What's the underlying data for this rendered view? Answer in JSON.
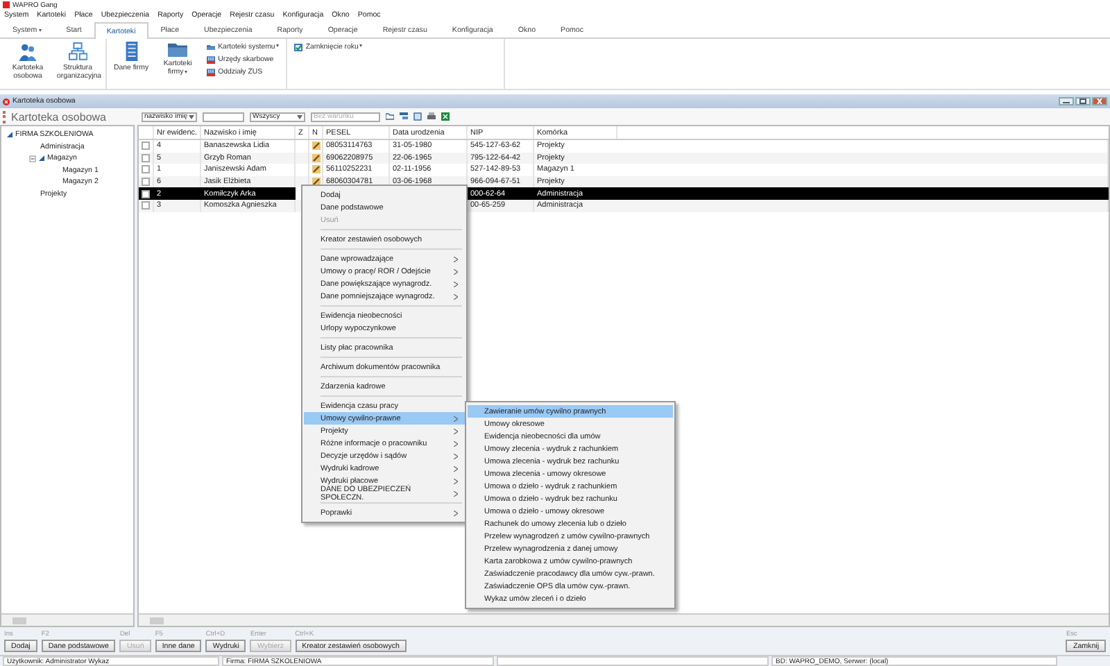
{
  "app": {
    "title": "WAPRO Gang"
  },
  "menu_bar": [
    "System",
    "Kartoteki",
    "Płace",
    "Ubezpieczenia",
    "Raporty",
    "Operacje",
    "Rejestr czasu",
    "Konfiguracja",
    "Okno",
    "Pomoc"
  ],
  "ribbon_tabs": [
    {
      "label": "System",
      "selected": false,
      "dropdown": true
    },
    {
      "label": "Start",
      "selected": false,
      "dropdown": false
    },
    {
      "label": "Kartoteki",
      "selected": true,
      "dropdown": false
    },
    {
      "label": "Płace",
      "selected": false,
      "dropdown": false
    },
    {
      "label": "Ubezpieczenia",
      "selected": false,
      "dropdown": false
    },
    {
      "label": "Raporty",
      "selected": false,
      "dropdown": false
    },
    {
      "label": "Operacje",
      "selected": false,
      "dropdown": false
    },
    {
      "label": "Rejestr czasu",
      "selected": false,
      "dropdown": false
    },
    {
      "label": "Konfiguracja",
      "selected": false,
      "dropdown": false
    },
    {
      "label": "Okno",
      "selected": false,
      "dropdown": false
    },
    {
      "label": "Pomoc",
      "selected": false,
      "dropdown": false
    }
  ],
  "ribbon_groups": [
    {
      "large_buttons": [
        {
          "label": "Kartoteka osobowa",
          "dropdown": false
        },
        {
          "label": "Struktura organizacyjna",
          "dropdown": false
        }
      ]
    },
    {
      "large_buttons": [
        {
          "label": "Dane firmy",
          "dropdown": false
        },
        {
          "label": "Kartoteki firmy",
          "dropdown": true
        }
      ],
      "small_buttons": [
        {
          "label": "Kartoteki systemu",
          "dropdown": true
        },
        {
          "label": "Urzędy skarbowe",
          "dropdown": false
        },
        {
          "label": "Oddziały ZUS",
          "dropdown": false
        }
      ]
    },
    {
      "small_buttons": [
        {
          "label": "Zamknięcie roku",
          "dropdown": true
        }
      ]
    }
  ],
  "document": {
    "title": "Kartoteka osobowa",
    "heading": "Kartoteka osobowa",
    "sort_select": "nazwisko imię",
    "status_select": "Wszyscy",
    "condition": {
      "placeholder": "Bez warunku"
    }
  },
  "tree": [
    {
      "label": "FIRMA SZKOLENIOWA",
      "expanded": true,
      "children": [
        {
          "label": "Administracja"
        },
        {
          "label": "Magazyn",
          "expanded": true,
          "children": [
            {
              "label": "Magazyn 1"
            },
            {
              "label": "Magazyn 2"
            }
          ]
        },
        {
          "label": "Projekty"
        }
      ]
    }
  ],
  "table": {
    "columns": [
      "Nr ewidenc.",
      "Nazwisko i imię",
      "Z",
      "N",
      "PESEL",
      "Data urodzenia",
      "NIP",
      "Komórka"
    ],
    "rows": [
      {
        "selected": false,
        "note": true,
        "cells": [
          "4",
          "Banaszewska Lidia",
          "",
          "",
          "08053114763",
          "31-05-1980",
          "545-127-63-62",
          "Projekty"
        ]
      },
      {
        "selected": false,
        "note": true,
        "cells": [
          "5",
          "Grzyb Roman",
          "",
          "",
          "69062208975",
          "22-06-1965",
          "795-122-64-42",
          "Projekty"
        ]
      },
      {
        "selected": false,
        "note": true,
        "cells": [
          "1",
          "Janiszewski Adam",
          "",
          "",
          "56110252231",
          "02-11-1956",
          "527-142-89-53",
          "Magazyn 1"
        ]
      },
      {
        "selected": false,
        "note": true,
        "cells": [
          "6",
          "Jasik Elżbieta",
          "",
          "",
          "68060304781",
          "03-06-1968",
          "966-094-67-51",
          "Projekty"
        ]
      },
      {
        "selected": true,
        "cells": [
          "2",
          "Komiłczyk Arka",
          "",
          "",
          "",
          "",
          "000-62-64",
          "Administracja"
        ]
      },
      {
        "selected": false,
        "cells": [
          "3",
          "Komoszka Agnieszka",
          "",
          "",
          "",
          "",
          "00-65-259",
          "Administracja"
        ]
      }
    ]
  },
  "context_menu": [
    {
      "kind": "item",
      "label": "Dodaj",
      "disabled": false,
      "submenu": false,
      "selected": false
    },
    {
      "kind": "item",
      "label": "Dane podstawowe",
      "disabled": false,
      "submenu": false,
      "selected": false
    },
    {
      "kind": "item",
      "label": "Usuń",
      "disabled": true,
      "submenu": false,
      "selected": false
    },
    {
      "kind": "separator"
    },
    {
      "kind": "item",
      "label": "Kreator zestawień osobowych",
      "disabled": false,
      "submenu": false,
      "selected": false
    },
    {
      "kind": "separator"
    },
    {
      "kind": "item",
      "label": "Dane wprowadzające",
      "disabled": false,
      "submenu": true,
      "selected": false
    },
    {
      "kind": "item",
      "label": "Umowy o pracę/ ROR / Odejście",
      "disabled": false,
      "submenu": true,
      "selected": false
    },
    {
      "kind": "item",
      "label": "Dane powiększające wynagrodz.",
      "disabled": false,
      "submenu": true,
      "selected": false
    },
    {
      "kind": "item",
      "label": "Dane pomniejszające wynagrodz.",
      "disabled": false,
      "submenu": true,
      "selected": false
    },
    {
      "kind": "separator"
    },
    {
      "kind": "item",
      "label": "Ewidencja nieobecności",
      "disabled": false,
      "submenu": false,
      "selected": false
    },
    {
      "kind": "item",
      "label": "Urlopy wypoczynkowe",
      "disabled": false,
      "submenu": false,
      "selected": false
    },
    {
      "kind": "separator"
    },
    {
      "kind": "item",
      "label": "Listy płac pracownika",
      "disabled": false,
      "submenu": false,
      "selected": false
    },
    {
      "kind": "separator"
    },
    {
      "kind": "item",
      "label": "Archiwum dokumentów pracownika",
      "disabled": false,
      "submenu": false,
      "selected": false
    },
    {
      "kind": "separator"
    },
    {
      "kind": "item",
      "label": "Zdarzenia kadrowe",
      "disabled": false,
      "submenu": false,
      "selected": false
    },
    {
      "kind": "separator"
    },
    {
      "kind": "item",
      "label": "Ewidencja czasu pracy",
      "disabled": false,
      "submenu": false,
      "selected": false
    },
    {
      "kind": "item",
      "label": "Umowy cywilno-prawne",
      "disabled": false,
      "submenu": true,
      "selected": true
    },
    {
      "kind": "item",
      "label": "Projekty",
      "disabled": false,
      "submenu": true,
      "selected": false
    },
    {
      "kind": "item",
      "label": "Różne informacje o pracowniku",
      "disabled": false,
      "submenu": true,
      "selected": false
    },
    {
      "kind": "item",
      "label": "Decyzje urzędów i sądów",
      "disabled": false,
      "submenu": true,
      "selected": false
    },
    {
      "kind": "item",
      "label": "Wydruki kadrowe",
      "disabled": false,
      "submenu": true,
      "selected": false
    },
    {
      "kind": "item",
      "label": "Wydruki płacowe",
      "disabled": false,
      "submenu": true,
      "selected": false
    },
    {
      "kind": "item",
      "label": "DANE DO UBEZPIECZEŃ SPOŁECZN.",
      "disabled": false,
      "submenu": true,
      "selected": false
    },
    {
      "kind": "separator"
    },
    {
      "kind": "item",
      "label": "Poprawki",
      "disabled": false,
      "submenu": true,
      "selected": false
    }
  ],
  "submenu": [
    {
      "kind": "item",
      "label": "Zawieranie umów cywilno prawnych",
      "disabled": false,
      "submenu": false,
      "selected": true
    },
    {
      "kind": "item",
      "label": "Umowy okresowe",
      "disabled": false,
      "submenu": false,
      "selected": false
    },
    {
      "kind": "item",
      "label": "Ewidencja nieobecności dla umów",
      "disabled": false,
      "submenu": false,
      "selected": false
    },
    {
      "kind": "item",
      "label": "Umowy zlecenia - wydruk z rachunkiem",
      "disabled": false,
      "submenu": false,
      "selected": false
    },
    {
      "kind": "item",
      "label": "Umowa zlecenia - wydruk bez rachunku",
      "disabled": false,
      "submenu": false,
      "selected": false
    },
    {
      "kind": "item",
      "label": "Umowa zlecenia - umowy okresowe",
      "disabled": false,
      "submenu": false,
      "selected": false
    },
    {
      "kind": "item",
      "label": "Umowa o dzieło - wydruk z rachunkiem",
      "disabled": false,
      "submenu": false,
      "selected": false
    },
    {
      "kind": "item",
      "label": "Umowa o dzieło - wydruk bez rachunku",
      "disabled": false,
      "submenu": false,
      "selected": false
    },
    {
      "kind": "item",
      "label": "Umowa o dzieło - umowy okresowe",
      "disabled": false,
      "submenu": false,
      "selected": false
    },
    {
      "kind": "item",
      "label": "Rachunek do umowy zlecenia lub o dzieło",
      "disabled": false,
      "submenu": false,
      "selected": false
    },
    {
      "kind": "item",
      "label": "Przelew wynagrodzeń z umów cywilno-prawnych",
      "disabled": false,
      "submenu": false,
      "selected": false
    },
    {
      "kind": "item",
      "label": "Przelew wynagrodzenia z danej umowy",
      "disabled": false,
      "submenu": false,
      "selected": false
    },
    {
      "kind": "item",
      "label": "Karta zarobkowa z umów cywilno-prawnych",
      "disabled": false,
      "submenu": false,
      "selected": false
    },
    {
      "kind": "item",
      "label": "Zaświadczenie pracodawcy dla umów cyw.-prawn.",
      "disabled": false,
      "submenu": false,
      "selected": false
    },
    {
      "kind": "item",
      "label": "Zaświadczenie OPS dla umów cyw.-prawn.",
      "disabled": false,
      "submenu": false,
      "selected": false
    },
    {
      "kind": "item",
      "label": "Wykaz umów zleceń i o dzieło",
      "disabled": false,
      "submenu": false,
      "selected": false
    }
  ],
  "bottom_buttons": [
    {
      "shortcut": "Ins",
      "label": "Dodaj",
      "disabled": false
    },
    {
      "shortcut": "F2",
      "label": "Dane podstawowe",
      "disabled": false
    },
    {
      "shortcut": "Del",
      "label": "Usuń",
      "disabled": true
    },
    {
      "shortcut": "F5",
      "label": "Inne dane",
      "disabled": false
    },
    {
      "shortcut": "Ctrl+D",
      "label": "Wydruki",
      "disabled": false
    },
    {
      "shortcut": "Enter",
      "label": "Wybierz",
      "disabled": true
    },
    {
      "shortcut": "Ctrl+K",
      "label": "Kreator zestawień osobowych",
      "disabled": false
    }
  ],
  "close_button": {
    "shortcut": "Esc",
    "label": "Zamknij"
  },
  "status_bar": [
    "Użytkownik: Administrator Wykaz",
    "Firma: FIRMA SZKOLENIOWA",
    "BD: WAPRO_DEMO, Serwer: (local)"
  ]
}
